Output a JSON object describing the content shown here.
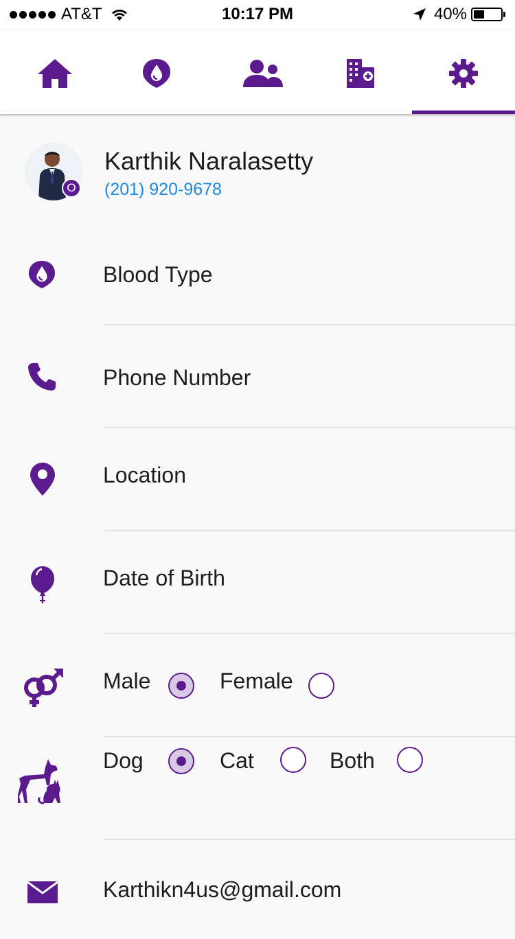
{
  "status_bar": {
    "carrier": "AT&T",
    "time": "10:17 PM",
    "battery": "40%",
    "battery_level": 0.4
  },
  "tabs": [
    {
      "name": "home-icon",
      "active": false
    },
    {
      "name": "blood-drop-icon",
      "active": false
    },
    {
      "name": "people-icon",
      "active": false
    },
    {
      "name": "hospital-icon",
      "active": false
    },
    {
      "name": "gear-icon",
      "active": true
    }
  ],
  "accent_color": "#5b1b8f",
  "link_color": "#1e88e5",
  "profile": {
    "name": "Karthik Naralasetty",
    "phone": "(201) 920-9678",
    "badge": "O"
  },
  "fields": {
    "blood_type": "Blood Type",
    "phone_number": "Phone Number",
    "location": "Location",
    "date_of_birth": "Date of Birth",
    "email": "Karthikn4us@gmail.com"
  },
  "gender": {
    "options": [
      "Male",
      "Female"
    ],
    "selected": "Male"
  },
  "pets": {
    "options": [
      "Dog",
      "Cat",
      "Both"
    ],
    "selected": "Dog"
  }
}
